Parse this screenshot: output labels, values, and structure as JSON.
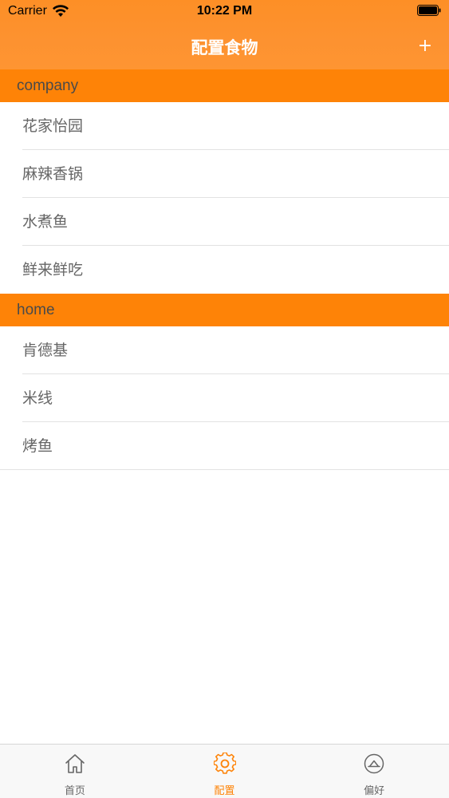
{
  "status_bar": {
    "carrier": "Carrier",
    "time": "10:22 PM"
  },
  "nav": {
    "title": "配置食物",
    "add_label": "+"
  },
  "sections": [
    {
      "title": "company",
      "items": [
        "花家怡园",
        "麻辣香锅",
        "水煮鱼",
        "鲜来鲜吃"
      ]
    },
    {
      "title": "home",
      "items": [
        "肯德基",
        "米线",
        "烤鱼"
      ]
    }
  ],
  "tabs": [
    {
      "label": "首页",
      "icon": "home-icon",
      "active": false
    },
    {
      "label": "配置",
      "icon": "gear-icon",
      "active": true
    },
    {
      "label": "偏好",
      "icon": "preference-icon",
      "active": false
    }
  ],
  "colors": {
    "accent": "#fe8307",
    "header": "#fd9230",
    "inactive": "#666666"
  }
}
